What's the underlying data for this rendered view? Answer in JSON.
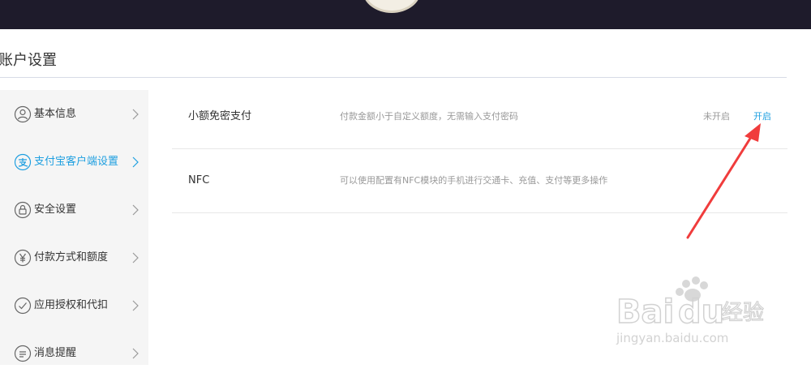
{
  "page_title": "账户设置",
  "sidebar": {
    "items": [
      {
        "label": "基本信息",
        "icon": "user-icon"
      },
      {
        "label": "支付宝客户端设置",
        "icon": "alipay-icon",
        "active": true
      },
      {
        "label": "安全设置",
        "icon": "lock-icon"
      },
      {
        "label": "付款方式和额度",
        "icon": "yen-icon"
      },
      {
        "label": "应用授权和代扣",
        "icon": "check-circle-icon"
      },
      {
        "label": "消息提醒",
        "icon": "message-icon"
      }
    ]
  },
  "settings": [
    {
      "name": "小额免密支付",
      "description": "付款金额小于自定义额度，无需输入支付密码",
      "status": "未开启",
      "action": "开启"
    },
    {
      "name": "NFC",
      "description": "可以使用配置有NFC模块的手机进行交通卡、充值、支付等更多操作"
    }
  ],
  "watermark": {
    "brand": "Baidu经验",
    "url": "jingyan.baidu.com"
  },
  "colors": {
    "accent": "#1e9fe0",
    "topbar": "#1e1b2b",
    "annotation_arrow": "#f03c3c"
  }
}
